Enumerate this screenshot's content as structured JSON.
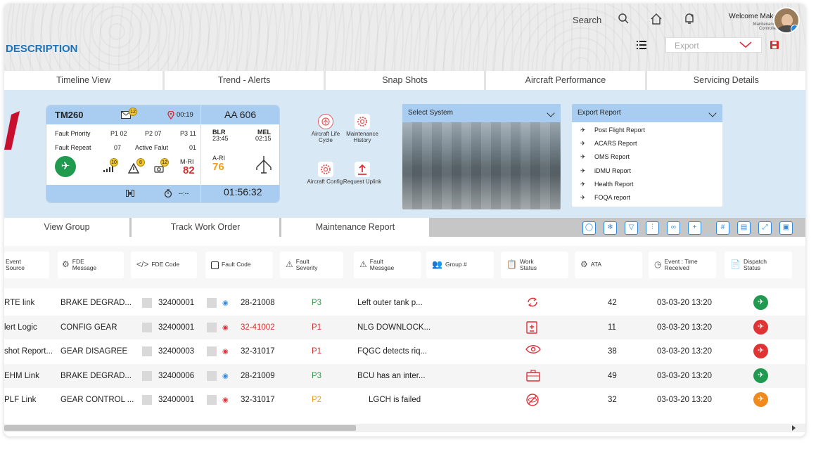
{
  "header": {
    "title": "DESCRIPTION",
    "search_label": "Search",
    "welcome": "Welcome Mako",
    "role": "Maintenance Controller",
    "export_placeholder": "Export"
  },
  "tabs": [
    "Timeline View",
    "Trend - Alerts",
    "Snap Shots",
    "Aircraft Performance",
    "Servicing Details"
  ],
  "flight_card": {
    "tail": "TM260",
    "msg_count": "12",
    "time": "00:19",
    "flight": "AA 606",
    "fault_priority_label": "Fault Priority",
    "p1": "P1 02",
    "p2": "P2 07",
    "p3": "P3 11",
    "fault_repeat_label": "Fault Repeat",
    "fault_repeat": "07",
    "active_fault_label": "Active Falut",
    "active_fault": "01",
    "origin": "BLR",
    "origin_time": "23:45",
    "dest": "MEL",
    "dest_time": "02:15",
    "ari_label": "A-RI",
    "ari": "76",
    "mri_label": "M-RI",
    "mri": "82",
    "badge_a": "10",
    "badge_b": "8",
    "badge_c": "12",
    "timer_dash": "--:--",
    "elapsed": "01:56:32"
  },
  "actions": {
    "lifecycle": "Aircraft Life Cycle",
    "history": "Maintenance History",
    "config": "Aircraft Config.",
    "uplink": "Request Uplink"
  },
  "system_select": "Select System",
  "export_report": {
    "title": "Export Report",
    "items": [
      "Post Flight Report",
      "ACARS Report",
      "OMS Report",
      "iDMU Report",
      "Health Report",
      "FOQA report"
    ]
  },
  "subtabs": [
    "View Group",
    "Track Work Order",
    "Maintenance Report"
  ],
  "columns": [
    "Event Source",
    "FDE Message",
    "FDE Code",
    "Fault Code",
    "Fault Severity",
    "Fault Messgae",
    "Group #",
    "Work Status",
    "ATA",
    "Event : Time Received",
    "Dispatch Status"
  ],
  "rows": [
    {
      "source": "RTE link",
      "message": "BRAKE DEGRAD...",
      "code": "32400001",
      "fault": "28-21008",
      "severity": "P3",
      "fault_msg": "Left outer tank p...",
      "ata": "42",
      "time": "03-03-20 13:20"
    },
    {
      "source": "lert Logic",
      "message": "CONFIG GEAR",
      "code": "32400001",
      "fault": "32-41002",
      "severity": "P1",
      "fault_msg": "NLG DOWNLOCK...",
      "ata": "11",
      "time": "03-03-20 13:20"
    },
    {
      "source": "shot Report...",
      "message": "GEAR DISAGREE",
      "code": "32400003",
      "fault": "32-31017",
      "severity": "P1",
      "fault_msg": "FQGC detects riq...",
      "ata": "38",
      "time": "03-03-20 13:20"
    },
    {
      "source": "EHM Link",
      "message": "BRAKE DEGRAD...",
      "code": "32400006",
      "fault": "28-21009",
      "severity": "P3",
      "fault_msg": "BCU has an inter...",
      "ata": "49",
      "time": "03-03-20 13:20"
    },
    {
      "source": "PLF Link",
      "message": "GEAR CONTROL ...",
      "code": "32400001",
      "fault": "32-31017",
      "severity": "P2",
      "fault_msg": "LGCH is failed",
      "ata": "32",
      "time": "03-03-20 13:20"
    }
  ],
  "colors": {
    "accent": "#1e72b8",
    "p1": "#d62f2f",
    "p2": "#f0a020",
    "p3": "#2e9e4a",
    "go": "#1f9a4f",
    "nogo": "#e03434",
    "caution": "#f08a1d"
  }
}
